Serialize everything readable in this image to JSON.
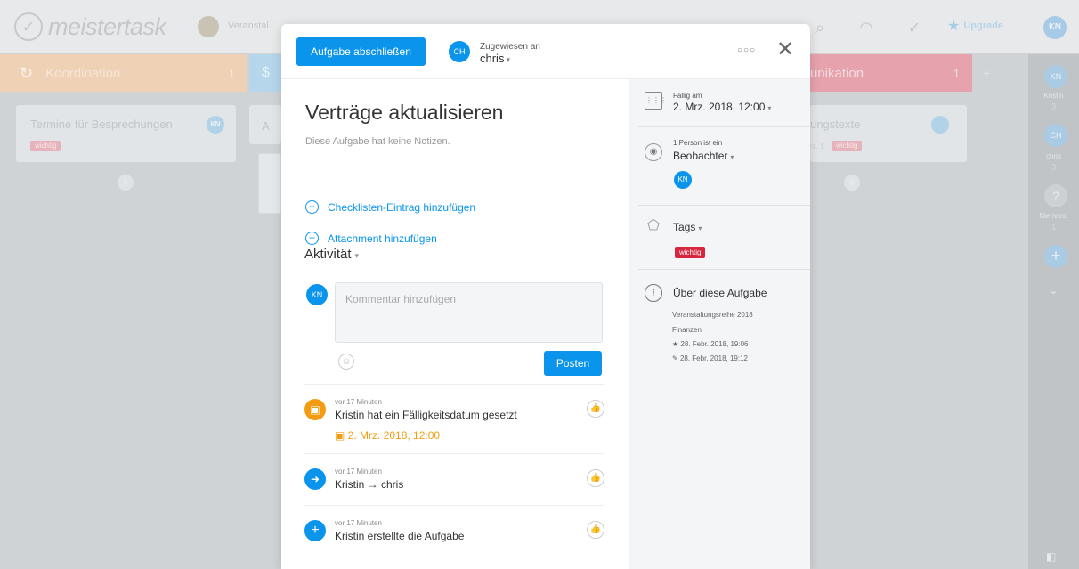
{
  "background": {
    "app_logo": "meistertask",
    "project_name": "Veranstal",
    "upgrade_label": "Upgrade",
    "user_initials": "KN",
    "sections": [
      {
        "name": "Koordination",
        "count": "1"
      },
      {
        "name": "unikation",
        "count": "1"
      }
    ],
    "cards": [
      {
        "title": "Termine für Besprechungen",
        "avatar": "KN",
        "tag": "wichtig"
      },
      {
        "title": "A"
      },
      {
        "title": "ungstexte",
        "sub": "rz. 1",
        "tag": "wichtig"
      }
    ],
    "rail": {
      "kristin": {
        "initials": "KN",
        "label": "Kristin",
        "count": "3"
      },
      "chris": {
        "initials": "CH",
        "label": "chris",
        "count": "3"
      },
      "niemand": {
        "label": "Niemand",
        "count": "1"
      }
    }
  },
  "modal": {
    "complete_button": "Aufgabe abschließen",
    "assigned_label": "Zugewiesen an",
    "assignee_initials": "CH",
    "assignee_name": "chris",
    "title": "Verträge aktualisieren",
    "notes": "Diese Aufgabe hat keine Notizen.",
    "add_checklist": "Checklisten-Eintrag hinzufügen",
    "add_attachment": "Attachment hinzufügen",
    "activity_heading": "Aktivität",
    "comment": {
      "avatar": "KN",
      "placeholder": "Kommentar hinzufügen",
      "post_button": "Posten"
    },
    "activities": [
      {
        "time": "vor 17 Minuten",
        "text": "Kristin hat ein Fälligkeitsdatum gesetzt",
        "date": "2. Mrz. 2018, 12:00",
        "color": "#f39c12"
      },
      {
        "time": "vor 17 Minuten",
        "text": "Kristin → chris",
        "color": "#0a94ec"
      },
      {
        "time": "vor 17 Minuten",
        "text": "Kristin erstellte die Aufgabe",
        "color": "#0a94ec"
      }
    ],
    "sidebar": {
      "due_label": "Fällig am",
      "due_value": "2. Mrz. 2018, 12:00",
      "watchers_small": "1 Person ist ein",
      "watchers_label": "Beobachter",
      "watcher_initials": "KN",
      "tags_label": "Tags",
      "tag": "wichtig",
      "about_label": "Über diese Aufgabe",
      "about": {
        "project": "Veranstaltungsreihe 2018",
        "section": "Finanzen",
        "created": "28. Febr. 2018, 19:06",
        "edited": "28. Febr. 2018, 19:12"
      }
    }
  },
  "colors": {
    "primary": "#0a94ec",
    "tag_red": "#d7263d",
    "due_orange": "#f39c12"
  }
}
